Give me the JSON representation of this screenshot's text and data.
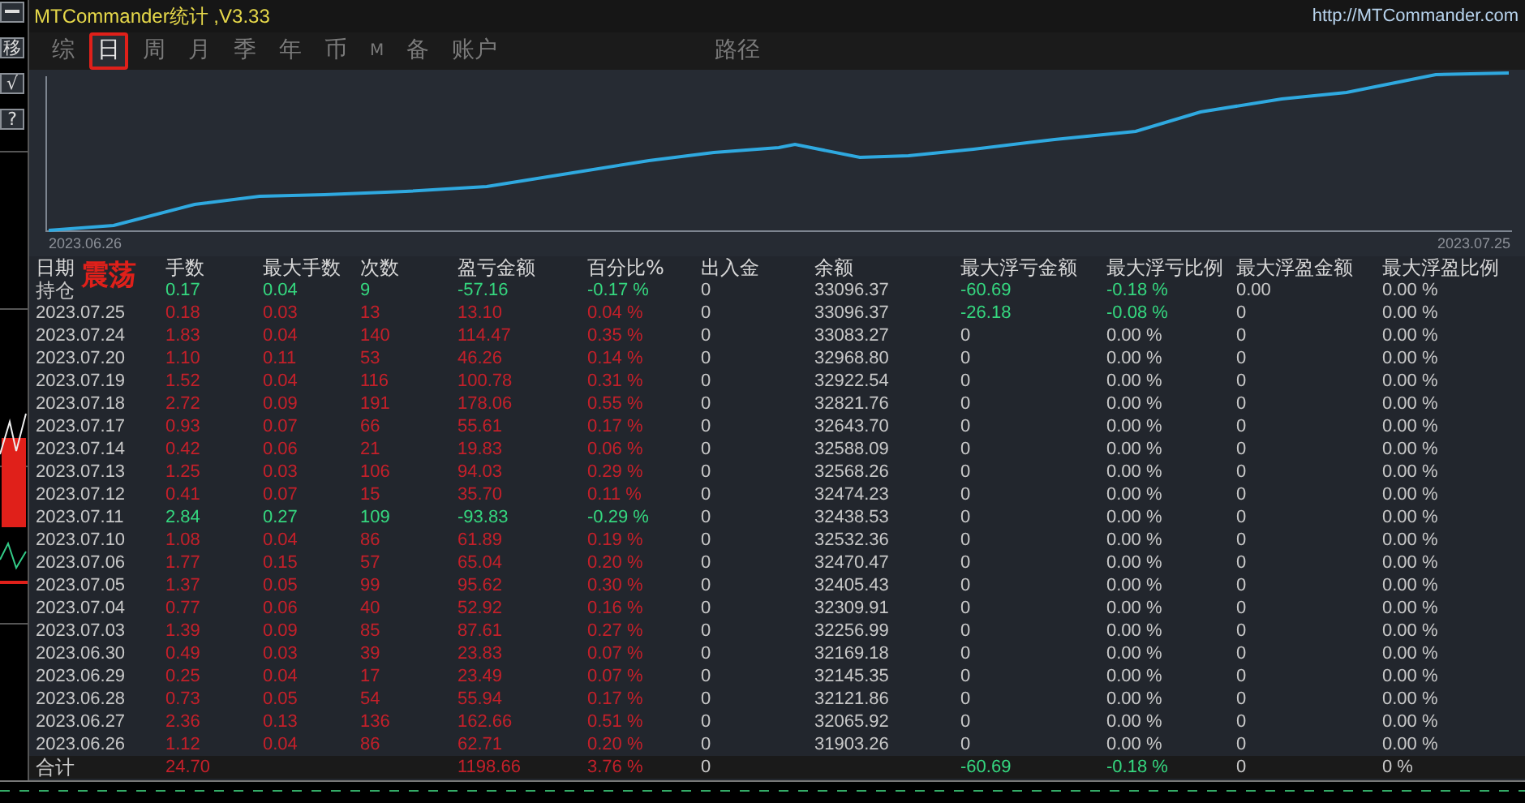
{
  "window": {
    "title": "MTCommander统计 ,V3.33",
    "link": "http://MTCommander.com"
  },
  "side_toolbar": {
    "buttons": [
      "移",
      "√",
      "?"
    ]
  },
  "tabs": [
    {
      "label": "综",
      "selected": false
    },
    {
      "label": "日",
      "selected": true
    },
    {
      "label": "周",
      "selected": false
    },
    {
      "label": "月",
      "selected": false
    },
    {
      "label": "季",
      "selected": false
    },
    {
      "label": "年",
      "selected": false
    },
    {
      "label": "币",
      "selected": false
    },
    {
      "label": "M",
      "selected": false
    },
    {
      "label": "备",
      "selected": false
    },
    {
      "label": "账户",
      "selected": false
    },
    {
      "label": "路径",
      "selected": false
    }
  ],
  "equity_chart": {
    "start_date": "2023.06.26",
    "end_date": "2023.07.25"
  },
  "table": {
    "market_state": "震荡",
    "columns": [
      "日期",
      "手数",
      "最大手数",
      "次数",
      "盈亏金额",
      "百分比%",
      "出入金",
      "余额",
      "最大浮亏金额",
      "最大浮亏比例",
      "最大浮盈金额",
      "最大浮盈比例"
    ],
    "rows": [
      {
        "kind": "position",
        "negative": true,
        "floating_loss": true,
        "cells": [
          "持仓",
          "0.17",
          "0.04",
          "9",
          "-57.16",
          "-0.17 %",
          "0",
          "33096.37",
          "-60.69",
          "-0.18 %",
          "0.00",
          "0.00 %"
        ]
      },
      {
        "kind": "day",
        "negative": false,
        "floating_loss": true,
        "cells": [
          "2023.07.25",
          "0.18",
          "0.03",
          "13",
          "13.10",
          "0.04 %",
          "0",
          "33096.37",
          "-26.18",
          "-0.08 %",
          "0",
          "0.00 %"
        ]
      },
      {
        "kind": "day",
        "negative": false,
        "floating_loss": false,
        "cells": [
          "2023.07.24",
          "1.83",
          "0.04",
          "140",
          "114.47",
          "0.35 %",
          "0",
          "33083.27",
          "0",
          "0.00 %",
          "0",
          "0.00 %"
        ]
      },
      {
        "kind": "day",
        "negative": false,
        "floating_loss": false,
        "cells": [
          "2023.07.20",
          "1.10",
          "0.11",
          "53",
          "46.26",
          "0.14 %",
          "0",
          "32968.80",
          "0",
          "0.00 %",
          "0",
          "0.00 %"
        ]
      },
      {
        "kind": "day",
        "negative": false,
        "floating_loss": false,
        "cells": [
          "2023.07.19",
          "1.52",
          "0.04",
          "116",
          "100.78",
          "0.31 %",
          "0",
          "32922.54",
          "0",
          "0.00 %",
          "0",
          "0.00 %"
        ]
      },
      {
        "kind": "day",
        "negative": false,
        "floating_loss": false,
        "cells": [
          "2023.07.18",
          "2.72",
          "0.09",
          "191",
          "178.06",
          "0.55 %",
          "0",
          "32821.76",
          "0",
          "0.00 %",
          "0",
          "0.00 %"
        ]
      },
      {
        "kind": "day",
        "negative": false,
        "floating_loss": false,
        "cells": [
          "2023.07.17",
          "0.93",
          "0.07",
          "66",
          "55.61",
          "0.17 %",
          "0",
          "32643.70",
          "0",
          "0.00 %",
          "0",
          "0.00 %"
        ]
      },
      {
        "kind": "day",
        "negative": false,
        "floating_loss": false,
        "cells": [
          "2023.07.14",
          "0.42",
          "0.06",
          "21",
          "19.83",
          "0.06 %",
          "0",
          "32588.09",
          "0",
          "0.00 %",
          "0",
          "0.00 %"
        ]
      },
      {
        "kind": "day",
        "negative": false,
        "floating_loss": false,
        "cells": [
          "2023.07.13",
          "1.25",
          "0.03",
          "106",
          "94.03",
          "0.29 %",
          "0",
          "32568.26",
          "0",
          "0.00 %",
          "0",
          "0.00 %"
        ]
      },
      {
        "kind": "day",
        "negative": false,
        "floating_loss": false,
        "cells": [
          "2023.07.12",
          "0.41",
          "0.07",
          "15",
          "35.70",
          "0.11 %",
          "0",
          "32474.23",
          "0",
          "0.00 %",
          "0",
          "0.00 %"
        ]
      },
      {
        "kind": "day",
        "negative": true,
        "floating_loss": false,
        "cells": [
          "2023.07.11",
          "2.84",
          "0.27",
          "109",
          "-93.83",
          "-0.29 %",
          "0",
          "32438.53",
          "0",
          "0.00 %",
          "0",
          "0.00 %"
        ]
      },
      {
        "kind": "day",
        "negative": false,
        "floating_loss": false,
        "cells": [
          "2023.07.10",
          "1.08",
          "0.04",
          "86",
          "61.89",
          "0.19 %",
          "0",
          "32532.36",
          "0",
          "0.00 %",
          "0",
          "0.00 %"
        ]
      },
      {
        "kind": "day",
        "negative": false,
        "floating_loss": false,
        "cells": [
          "2023.07.06",
          "1.77",
          "0.15",
          "57",
          "65.04",
          "0.20 %",
          "0",
          "32470.47",
          "0",
          "0.00 %",
          "0",
          "0.00 %"
        ]
      },
      {
        "kind": "day",
        "negative": false,
        "floating_loss": false,
        "cells": [
          "2023.07.05",
          "1.37",
          "0.05",
          "99",
          "95.62",
          "0.30 %",
          "0",
          "32405.43",
          "0",
          "0.00 %",
          "0",
          "0.00 %"
        ]
      },
      {
        "kind": "day",
        "negative": false,
        "floating_loss": false,
        "cells": [
          "2023.07.04",
          "0.77",
          "0.06",
          "40",
          "52.92",
          "0.16 %",
          "0",
          "32309.91",
          "0",
          "0.00 %",
          "0",
          "0.00 %"
        ]
      },
      {
        "kind": "day",
        "negative": false,
        "floating_loss": false,
        "cells": [
          "2023.07.03",
          "1.39",
          "0.09",
          "85",
          "87.61",
          "0.27 %",
          "0",
          "32256.99",
          "0",
          "0.00 %",
          "0",
          "0.00 %"
        ]
      },
      {
        "kind": "day",
        "negative": false,
        "floating_loss": false,
        "cells": [
          "2023.06.30",
          "0.49",
          "0.03",
          "39",
          "23.83",
          "0.07 %",
          "0",
          "32169.18",
          "0",
          "0.00 %",
          "0",
          "0.00 %"
        ]
      },
      {
        "kind": "day",
        "negative": false,
        "floating_loss": false,
        "cells": [
          "2023.06.29",
          "0.25",
          "0.04",
          "17",
          "23.49",
          "0.07 %",
          "0",
          "32145.35",
          "0",
          "0.00 %",
          "0",
          "0.00 %"
        ]
      },
      {
        "kind": "day",
        "negative": false,
        "floating_loss": false,
        "cells": [
          "2023.06.28",
          "0.73",
          "0.05",
          "54",
          "55.94",
          "0.17 %",
          "0",
          "32121.86",
          "0",
          "0.00 %",
          "0",
          "0.00 %"
        ]
      },
      {
        "kind": "day",
        "negative": false,
        "floating_loss": false,
        "cells": [
          "2023.06.27",
          "2.36",
          "0.13",
          "136",
          "162.66",
          "0.51 %",
          "0",
          "32065.92",
          "0",
          "0.00 %",
          "0",
          "0.00 %"
        ]
      },
      {
        "kind": "day",
        "negative": false,
        "floating_loss": false,
        "cells": [
          "2023.06.26",
          "1.12",
          "0.04",
          "86",
          "62.71",
          "0.20 %",
          "0",
          "31903.26",
          "0",
          "0.00 %",
          "0",
          "0.00 %"
        ]
      },
      {
        "kind": "total",
        "negative": false,
        "floating_loss": true,
        "cells": [
          "合计",
          "24.70",
          null,
          null,
          "1198.66",
          "3.76 %",
          "0",
          null,
          "-60.69",
          "-0.18 %",
          "0",
          "0 %"
        ]
      }
    ]
  }
}
